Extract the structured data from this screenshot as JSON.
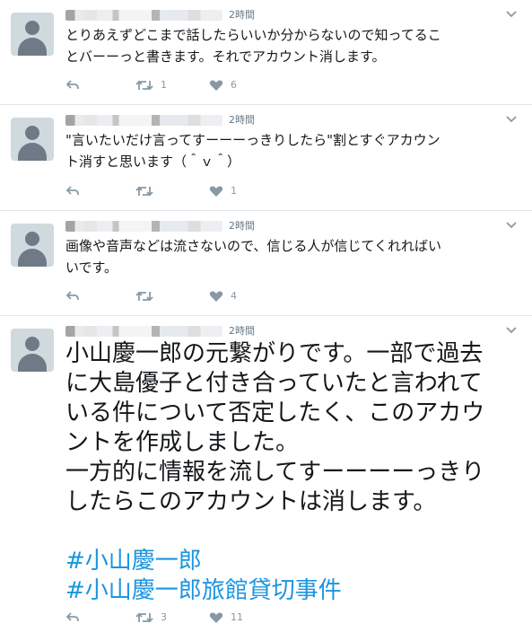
{
  "colors": {
    "text": "#14171a",
    "secondary": "#657786",
    "icon": "#8899a6",
    "hashtag": "#1b95e0",
    "divider": "#e1e8ed"
  },
  "tweets": [
    {
      "timestamp": "2時間",
      "text": "とりあえずどこまで話したらいいか分からないので知ってるこ\nとバーーっと書きます。それでアカウント消します。",
      "reply_count": "",
      "retweet_count": "1",
      "like_count": "6"
    },
    {
      "timestamp": "2時間",
      "text": "\"言いたいだけ言ってすーーーっきりしたら\"割とすぐアカウン\nト消すと思います（＾ｖ＾）",
      "reply_count": "",
      "retweet_count": "",
      "like_count": "1"
    },
    {
      "timestamp": "2時間",
      "text": "画像や音声などは流さないので、信じる人が信じてくれればい\nいです。",
      "reply_count": "",
      "retweet_count": "",
      "like_count": "4"
    },
    {
      "timestamp": "2時間",
      "text_lines": [
        "小山慶一郎の元繋がりです。一部で過去",
        "に大島優子と付き合っていたと言われて",
        "いる件について否定したく、このアカウ",
        "ントを作成しました。",
        "一方的に情報を流してすーーーーっきり",
        "したらこのアカウントは消します。"
      ],
      "hashtags": [
        "#小山慶一郎",
        "#小山慶一郎旅館貸切事件"
      ],
      "reply_count": "",
      "retweet_count": "3",
      "like_count": "11"
    }
  ],
  "icons": {
    "avatar": "default-avatar-icon",
    "menu": "chevron-down-icon",
    "reply": "reply-icon",
    "retweet": "retweet-icon",
    "like": "heart-icon"
  }
}
